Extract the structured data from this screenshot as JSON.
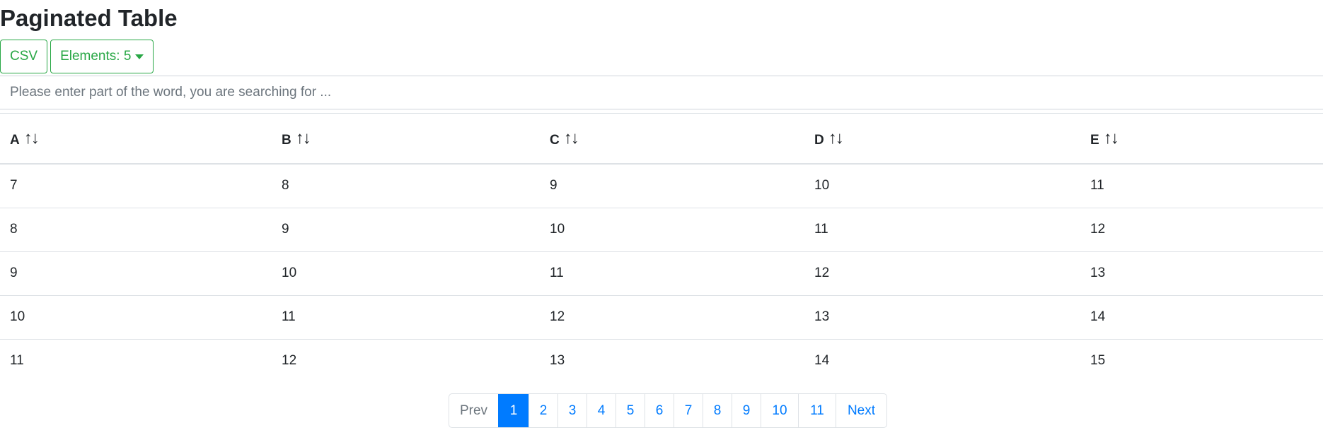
{
  "page": {
    "title": "Paginated Table"
  },
  "toolbar": {
    "csv_label": "CSV",
    "elements_label": "Elements: 5"
  },
  "search": {
    "placeholder": "Please enter part of the word, you are searching for ..."
  },
  "table": {
    "headers": [
      "A",
      "B",
      "C",
      "D",
      "E"
    ],
    "sort_glyph": "↑↓",
    "rows": [
      [
        "7",
        "8",
        "9",
        "10",
        "11"
      ],
      [
        "8",
        "9",
        "10",
        "11",
        "12"
      ],
      [
        "9",
        "10",
        "11",
        "12",
        "13"
      ],
      [
        "10",
        "11",
        "12",
        "13",
        "14"
      ],
      [
        "11",
        "12",
        "13",
        "14",
        "15"
      ]
    ]
  },
  "pagination": {
    "prev": "Prev",
    "pages": [
      "1",
      "2",
      "3",
      "4",
      "5",
      "6",
      "7",
      "8",
      "9",
      "10",
      "11"
    ],
    "active": "1",
    "next": "Next"
  },
  "colors": {
    "success": "#28a745",
    "primary": "#007bff",
    "muted": "#6c757d"
  }
}
